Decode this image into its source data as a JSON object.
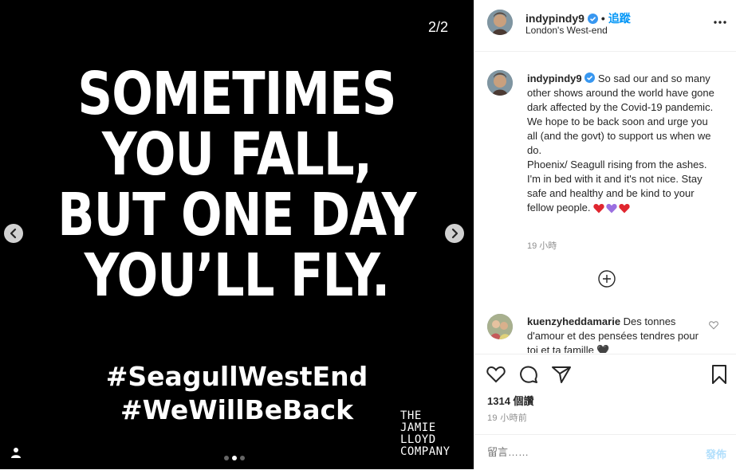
{
  "media": {
    "counter": "2/2",
    "slogan": [
      "SOMETIMES",
      "YOU FALL,",
      "BUT ONE DAY",
      "YOU’LL FLY."
    ],
    "hashtags": [
      "#SeagullWestEnd",
      "#WeWillBeBack"
    ],
    "logo_lines": [
      "THE",
      "JAMIE",
      "LLOYD",
      "COMPANY"
    ],
    "carousel": {
      "total": 3,
      "active_index": 1
    }
  },
  "header": {
    "username": "indypindy9",
    "follow_separator": "•",
    "follow_label": "追蹤",
    "location": "London's West-end"
  },
  "caption": {
    "username": "indypindy9",
    "lines": [
      "So sad our and so many other shows around the world have gone dark affected by the Covid-19 pandemic.",
      "We hope to be back soon and urge you all (and the govt) to support us when we do.",
      "Phoenix/ Seagull rising from the ashes. I'm in bed with it and it's not nice. Stay safe and healthy and be kind to your fellow people."
    ],
    "emoji": [
      "red-heart",
      "purple-heart",
      "red-heart"
    ],
    "time": "19 小時"
  },
  "comment": {
    "username": "kuenzyheddamarie",
    "text": "Des tonnes d'amour et des pensées tendres pour toi et ta famille 🖤"
  },
  "stats": {
    "likes": "1314 個讚",
    "time": "19 小時前"
  },
  "comment_box": {
    "placeholder": "留言……",
    "post_label": "發佈"
  },
  "colors": {
    "accent": "#0095f6",
    "post_disabled": "#b2dffc",
    "red_heart": "#e0262f",
    "purple_heart": "#9b6fe0"
  }
}
